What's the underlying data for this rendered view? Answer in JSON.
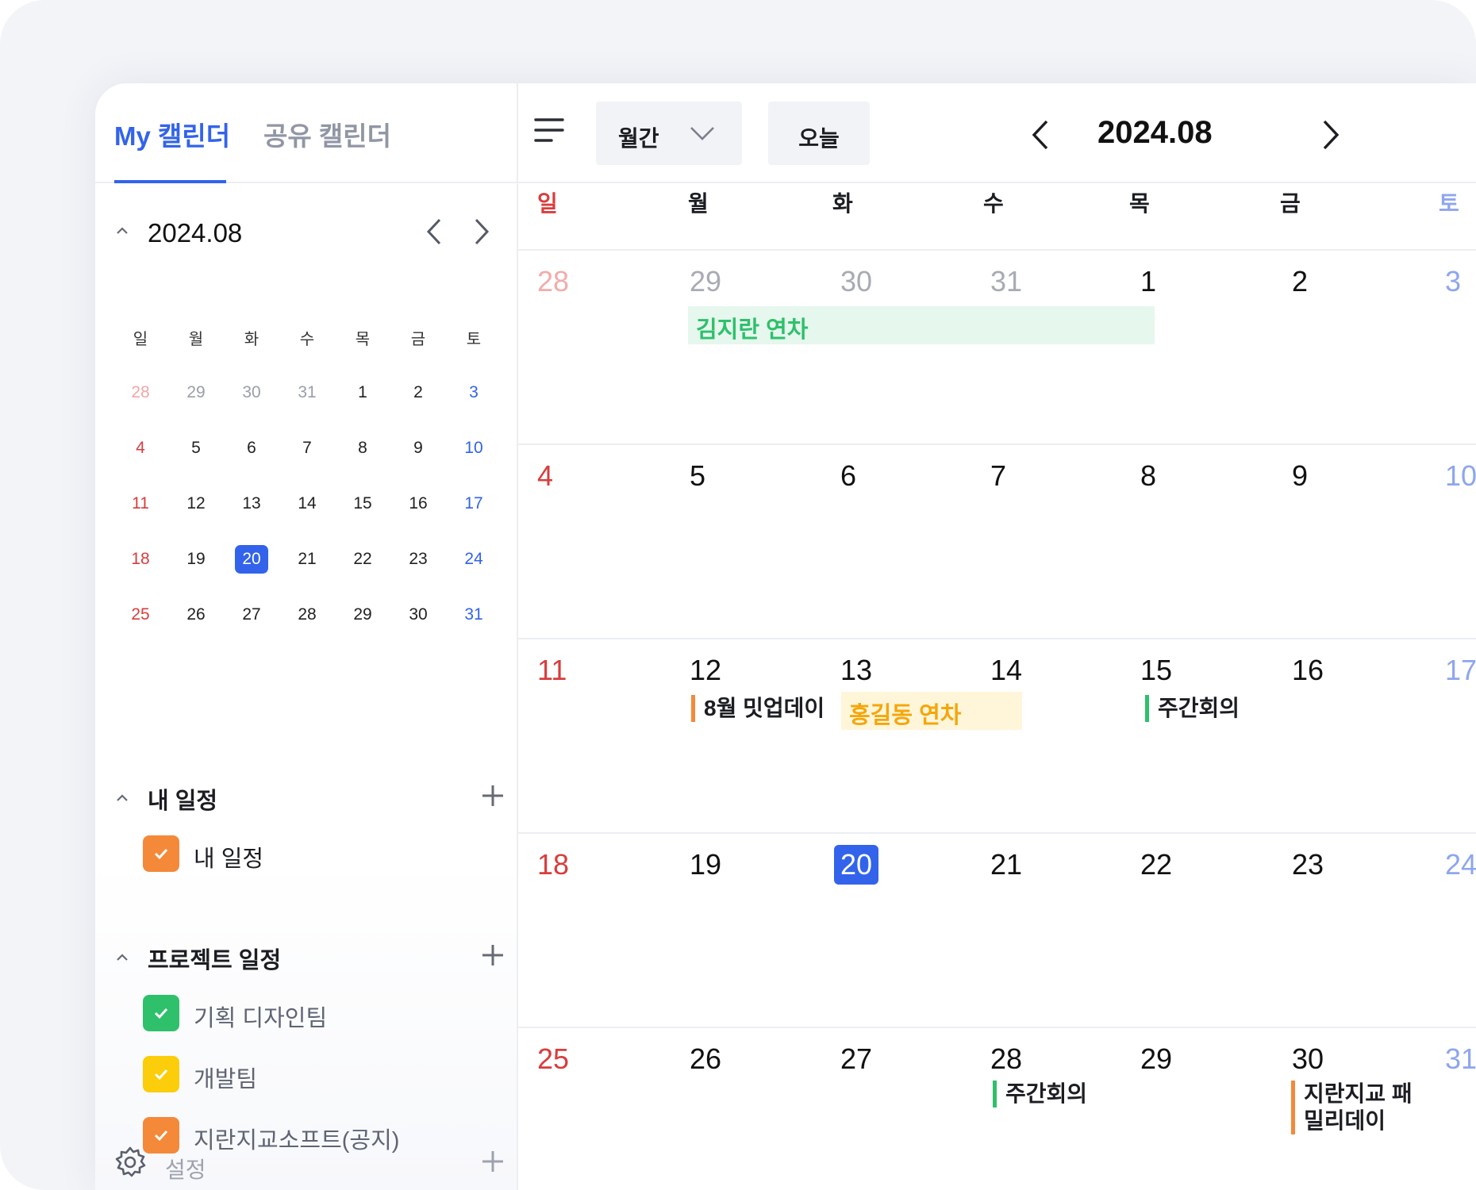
{
  "tabs": {
    "my": "My 캘린더",
    "shared": "공유 캘린더"
  },
  "mini_calendar": {
    "title": "2024.08",
    "weekdays": [
      "일",
      "월",
      "화",
      "수",
      "목",
      "금",
      "토"
    ],
    "weeks": [
      [
        "28",
        "29",
        "30",
        "31",
        "1",
        "2",
        "3"
      ],
      [
        "4",
        "5",
        "6",
        "7",
        "8",
        "9",
        "10"
      ],
      [
        "11",
        "12",
        "13",
        "14",
        "15",
        "16",
        "17"
      ],
      [
        "18",
        "19",
        "20",
        "21",
        "22",
        "23",
        "24"
      ],
      [
        "25",
        "26",
        "27",
        "28",
        "29",
        "30",
        "31"
      ]
    ],
    "today": "20"
  },
  "my_schedule": {
    "title": "내 일정",
    "calendars": [
      {
        "label": "내 일정",
        "color": "#f4893a"
      }
    ]
  },
  "project_schedule": {
    "title": "프로젝트 일정",
    "calendars": [
      {
        "label": "기획 디자인팀",
        "color": "#2ec06b"
      },
      {
        "label": "개발팀",
        "color": "#fbcd0a"
      },
      {
        "label": "지란지교소프트(공지)",
        "color": "#f4893a"
      }
    ]
  },
  "settings": {
    "label": "설정"
  },
  "toolbar": {
    "view_label": "월간",
    "today_label": "오늘",
    "title": "2024.08"
  },
  "month": {
    "weekdays": [
      "일",
      "월",
      "화",
      "수",
      "목",
      "금",
      "토"
    ],
    "weeks": [
      [
        "28",
        "29",
        "30",
        "31",
        "1",
        "2",
        "3"
      ],
      [
        "4",
        "5",
        "6",
        "7",
        "8",
        "9",
        "10"
      ],
      [
        "11",
        "12",
        "13",
        "14",
        "15",
        "16",
        "17"
      ],
      [
        "18",
        "19",
        "20",
        "21",
        "22",
        "23",
        "24"
      ],
      [
        "25",
        "26",
        "27",
        "28",
        "29",
        "30",
        "31"
      ]
    ],
    "today": "20",
    "events": [
      {
        "title": "김지란 연차",
        "color": "#2ec06b",
        "bg": "#e6f7ee"
      },
      {
        "title": "8월 밋업데이",
        "color": "#f4893a"
      },
      {
        "title": "홍길동 연차",
        "color": "#f5a60a",
        "bg": "#fff6da"
      },
      {
        "title": "주간회의",
        "color": "#2ec06b"
      },
      {
        "title": "주간회의",
        "color": "#2ec06b"
      },
      {
        "title": "지란지교 패밀리데이",
        "color": "#f4893a"
      }
    ]
  }
}
